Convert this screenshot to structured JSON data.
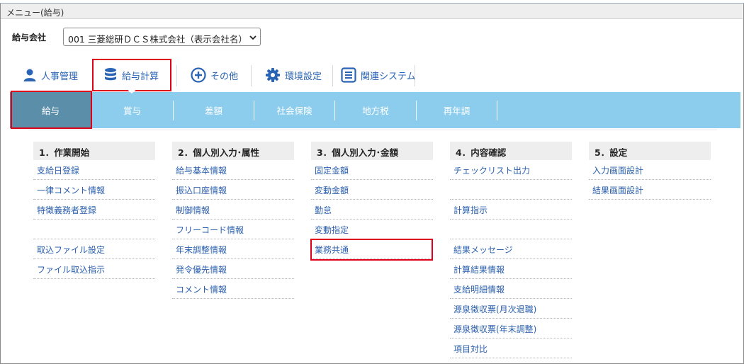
{
  "window": {
    "title": "メニュー(給与)"
  },
  "company": {
    "label": "給与会社",
    "selected": "001 三菱総研ＤＣＳ株式会社（表示会社名）"
  },
  "main_tabs": [
    {
      "label": "人事管理",
      "icon": "person-icon"
    },
    {
      "label": "給与計算",
      "icon": "database-icon"
    },
    {
      "label": "その他",
      "icon": "plus-circle-icon"
    },
    {
      "label": "環境設定",
      "icon": "gear-icon"
    },
    {
      "label": "関連システム",
      "icon": "list-box-icon"
    }
  ],
  "sub_tabs": [
    "給与",
    "賞与",
    "差額",
    "社会保険",
    "地方税",
    "再年調"
  ],
  "columns": [
    {
      "header": "1．作業開始",
      "items": [
        "支給日登録",
        "一律コメント情報",
        "特徴義務者登録",
        "",
        "取込ファイル設定",
        "ファイル取込指示"
      ]
    },
    {
      "header": "2．個人別入力･属性",
      "items": [
        "給与基本情報",
        "振込口座情報",
        "制御情報",
        "フリーコード情報",
        "年末調整情報",
        "発令優先情報",
        "コメント情報"
      ]
    },
    {
      "header": "3．個人別入力･金額",
      "items": [
        "固定金額",
        "変動金額",
        "勤怠",
        "変動指定",
        "業務共通"
      ]
    },
    {
      "header": "4．内容確認",
      "items": [
        "チェックリスト出力",
        "",
        "計算指示",
        "",
        "結果メッセージ",
        "計算結果情報",
        "支給明細情報",
        "源泉徴収票(月次退職)",
        "源泉徴収票(年末調整)",
        "項目対比"
      ]
    },
    {
      "header": "5．設定",
      "items": [
        "入力画面設計",
        "結果画面設計"
      ]
    }
  ],
  "colors": {
    "accent": "#2a64b4",
    "subbar": "#8ccdee",
    "subtab_active": "#5b8ea9",
    "highlight": "#e0001a"
  }
}
